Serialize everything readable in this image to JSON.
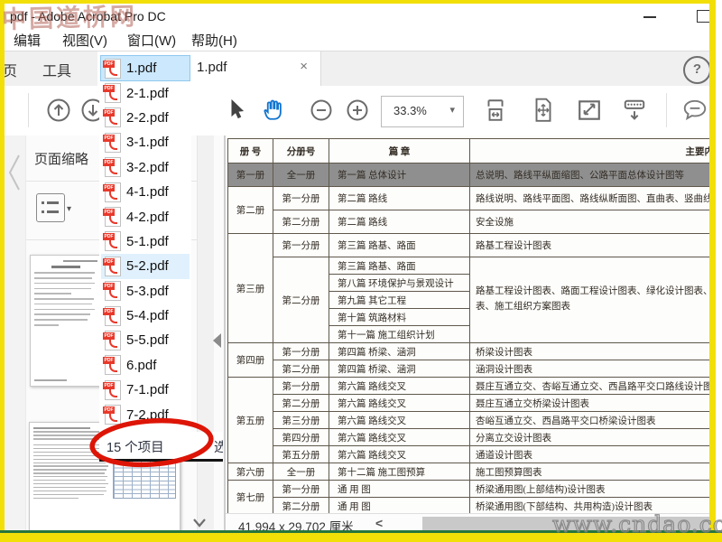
{
  "watermarks": {
    "top": "中国道桥网",
    "bottom": "www.cndao.com"
  },
  "frame": {
    "yellow": "#f2df07",
    "green": "#27753d"
  },
  "titlebar": {
    "title": "pdf - Adobe Acrobat Pro DC"
  },
  "menubar": {
    "items": [
      "编辑",
      "视图(V)",
      "窗口(W)",
      "帮助(H)"
    ]
  },
  "tabbar": {
    "home_tab": "页",
    "tools_tab": "工具",
    "document_tab": "1.pdf",
    "close_glyph": "×",
    "help_glyph": "?"
  },
  "toolbar": {
    "zoom_value": "33.3%",
    "caret_glyph": "▾"
  },
  "sidebar": {
    "panel_title": "页面缩略",
    "options_caret": "▾"
  },
  "file_list": {
    "items": [
      "1.pdf",
      "2-1.pdf",
      "2-2.pdf",
      "3-1.pdf",
      "3-2.pdf",
      "4-1.pdf",
      "4-2.pdf",
      "5-1.pdf",
      "5-2.pdf",
      "5-3.pdf",
      "5-4.pdf",
      "5-5.pdf",
      "6.pdf",
      "7-1.pdf",
      "7-2.pdf"
    ],
    "selected_index": 0,
    "highlighted_index": 8,
    "status_count": "15 个项目",
    "status_more": "选",
    "pdf_badge": "PDF"
  },
  "statusbar": {
    "page_dimensions": "41.994 x 29.702 厘米",
    "chevron_glyph": "<"
  },
  "document_table": {
    "headers": [
      "册 号",
      "分册号",
      "篇 章",
      "主要内容"
    ],
    "rows": [
      {
        "gray": true,
        "cells": [
          {
            "col": 0,
            "t": "第一册"
          },
          {
            "col": 1,
            "t": "全一册"
          },
          {
            "col": 2,
            "t": "第一篇 总体设计"
          },
          {
            "col": 3,
            "t": "总说明、路线平纵面缩图、公路平面总体设计图等"
          }
        ]
      },
      {
        "cells": [
          {
            "col": 0,
            "t": "第二册",
            "rs": 2
          },
          {
            "col": 1,
            "t": "第一分册"
          },
          {
            "col": 2,
            "t": "第二篇 路线"
          },
          {
            "col": 3,
            "t": "路线说明、路线平面图、路线纵断面图、直曲表、竖曲线表、用地图等"
          }
        ]
      },
      {
        "cells": [
          {
            "col": 1,
            "t": "第二分册"
          },
          {
            "col": 2,
            "t": "第二篇 路线"
          },
          {
            "col": 3,
            "t": "安全设施"
          }
        ]
      },
      {
        "cells": [
          {
            "col": 0,
            "t": "第三册",
            "rs": 6
          },
          {
            "col": 1,
            "t": "第一分册"
          },
          {
            "col": 2,
            "t": "第三篇 路基、路面"
          },
          {
            "col": 3,
            "t": "路基工程设计图表"
          }
        ]
      },
      {
        "cells": [
          {
            "col": 1,
            "t": "第二分册",
            "rs": 5
          },
          {
            "col": 2,
            "t": "第三篇 路基、路面"
          },
          {
            "col": 3,
            "t": "路基工程设计图表、路面工程设计图表、绿化设计图表、改路改沟设计图表、施工组织方案图表",
            "rs": 5,
            "narrow": true
          }
        ]
      },
      {
        "cells": [
          {
            "col": 2,
            "t": "第八篇 环境保护与景观设计"
          }
        ]
      },
      {
        "cells": [
          {
            "col": 2,
            "t": "第九篇 其它工程"
          }
        ]
      },
      {
        "cells": [
          {
            "col": 2,
            "t": "第十篇 筑路材料"
          }
        ]
      },
      {
        "cells": [
          {
            "col": 2,
            "t": "第十一篇 施工组织计划"
          }
        ]
      },
      {
        "cells": [
          {
            "col": 0,
            "t": "第四册",
            "rs": 2
          },
          {
            "col": 1,
            "t": "第一分册"
          },
          {
            "col": 2,
            "t": "第四篇 桥梁、涵洞"
          },
          {
            "col": 3,
            "t": "桥梁设计图表"
          }
        ]
      },
      {
        "cells": [
          {
            "col": 1,
            "t": "第二分册"
          },
          {
            "col": 2,
            "t": "第四篇 桥梁、涵洞"
          },
          {
            "col": 3,
            "t": "涵洞设计图表"
          }
        ]
      },
      {
        "cells": [
          {
            "col": 0,
            "t": "第五册",
            "rs": 5
          },
          {
            "col": 1,
            "t": "第一分册"
          },
          {
            "col": 2,
            "t": "第六篇 路线交叉"
          },
          {
            "col": 3,
            "t": "聂庄互通立交、杏峪互通立交、西昌路平交口路线设计图表"
          }
        ]
      },
      {
        "cells": [
          {
            "col": 1,
            "t": "第二分册"
          },
          {
            "col": 2,
            "t": "第六篇 路线交叉"
          },
          {
            "col": 3,
            "t": "聂庄互通立交桥梁设计图表"
          }
        ]
      },
      {
        "cells": [
          {
            "col": 1,
            "t": "第三分册"
          },
          {
            "col": 2,
            "t": "第六篇 路线交叉"
          },
          {
            "col": 3,
            "t": "杏峪互通立交、西昌路平交口桥梁设计图表"
          }
        ]
      },
      {
        "cells": [
          {
            "col": 1,
            "t": "第四分册"
          },
          {
            "col": 2,
            "t": "第六篇 路线交叉"
          },
          {
            "col": 3,
            "t": "分离立交设计图表"
          }
        ]
      },
      {
        "cells": [
          {
            "col": 1,
            "t": "第五分册"
          },
          {
            "col": 2,
            "t": "第六篇 路线交叉"
          },
          {
            "col": 3,
            "t": "通道设计图表"
          }
        ]
      },
      {
        "cells": [
          {
            "col": 0,
            "t": "第六册"
          },
          {
            "col": 1,
            "t": "全一册"
          },
          {
            "col": 2,
            "t": "第十二篇 施工图预算"
          },
          {
            "col": 3,
            "t": "施工图预算图表"
          }
        ]
      },
      {
        "cells": [
          {
            "col": 0,
            "t": "第七册",
            "rs": 2
          },
          {
            "col": 1,
            "t": "第一分册"
          },
          {
            "col": 2,
            "t": "通 用 图"
          },
          {
            "col": 3,
            "t": "桥梁通用图(上部结构)设计图表"
          }
        ]
      },
      {
        "cells": [
          {
            "col": 1,
            "t": "第二分册"
          },
          {
            "col": 2,
            "t": "通 用 图"
          },
          {
            "col": 3,
            "t": "桥梁通用图(下部结构、共用构造)设计图表"
          }
        ]
      }
    ]
  }
}
